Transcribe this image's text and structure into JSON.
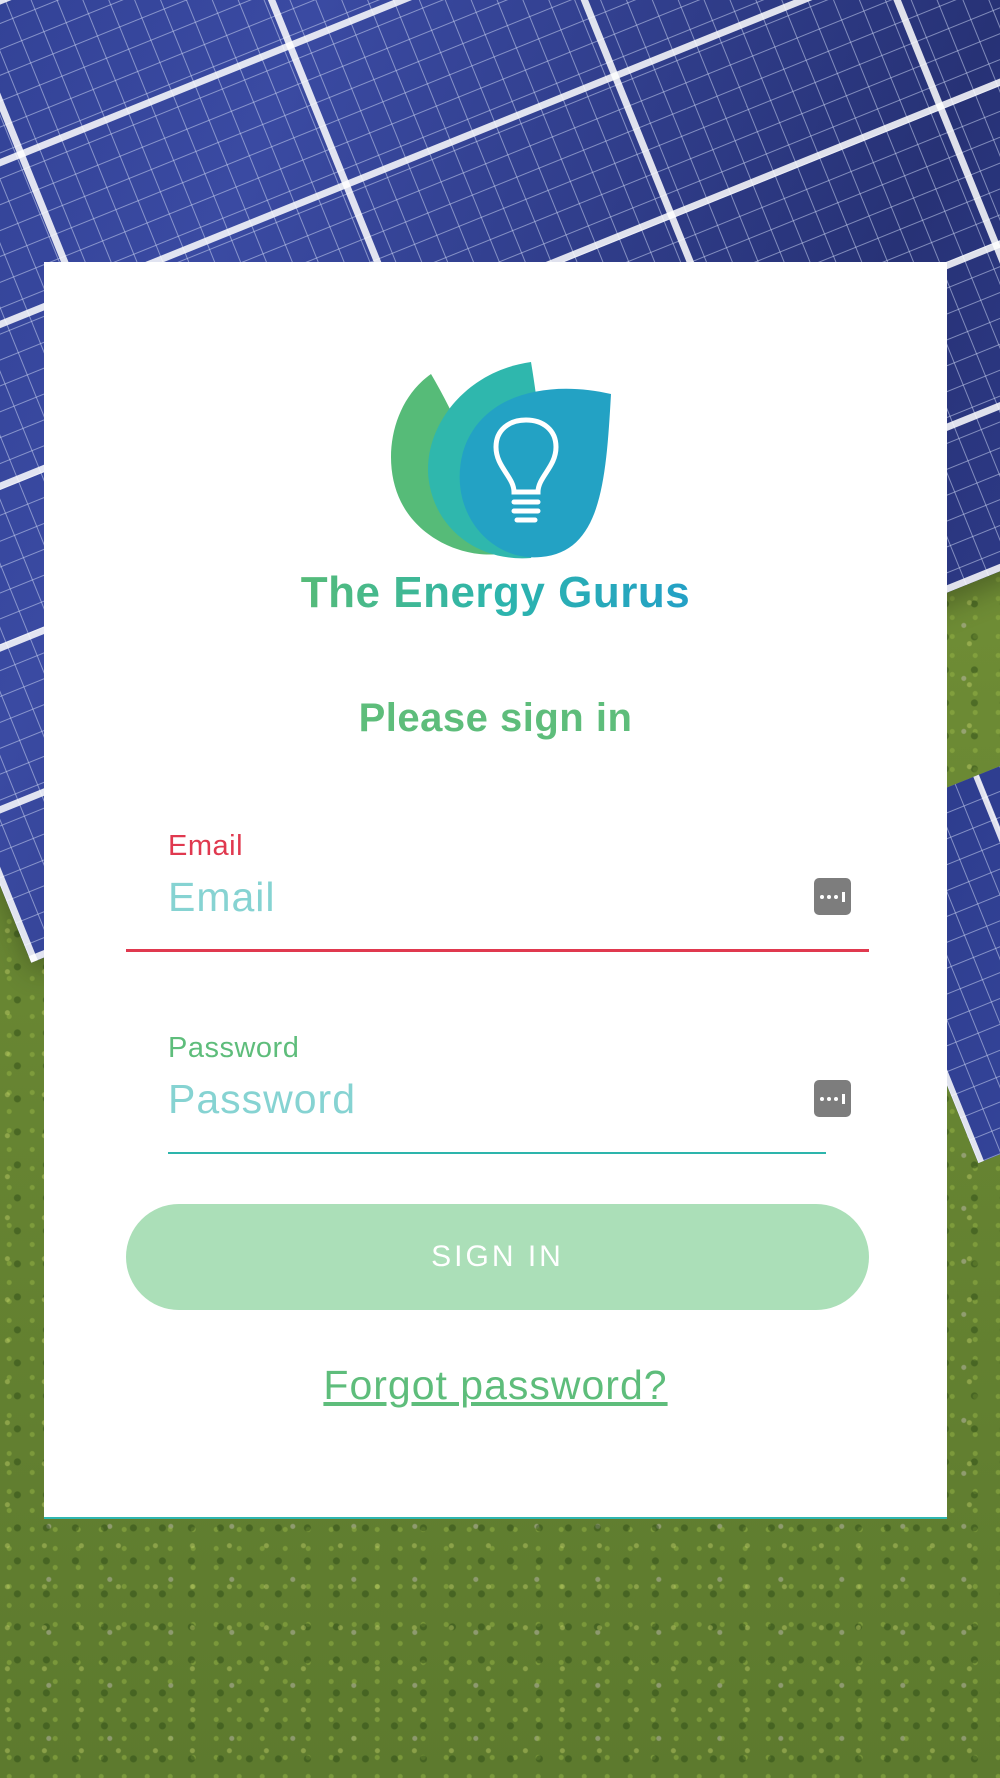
{
  "brand": {
    "name": "The Energy Gurus",
    "logo_icon": "lightbulb-leaf-icon"
  },
  "form": {
    "heading": "Please sign in",
    "email": {
      "label": "Email",
      "placeholder": "Email",
      "value": "",
      "state": "error",
      "icon": "password-manager-key-icon"
    },
    "password": {
      "label": "Password",
      "placeholder": "Password",
      "value": "",
      "icon": "password-manager-key-icon"
    },
    "submit_label": "SIGN IN",
    "forgot_label": "Forgot password?"
  },
  "colors": {
    "brand_green": "#5ebd7b",
    "brand_teal": "#2db5ac",
    "brand_blue": "#23a0c6",
    "error_red": "#e0394f",
    "placeholder": "#86d3d2",
    "button_disabled": "#abdfb8"
  }
}
